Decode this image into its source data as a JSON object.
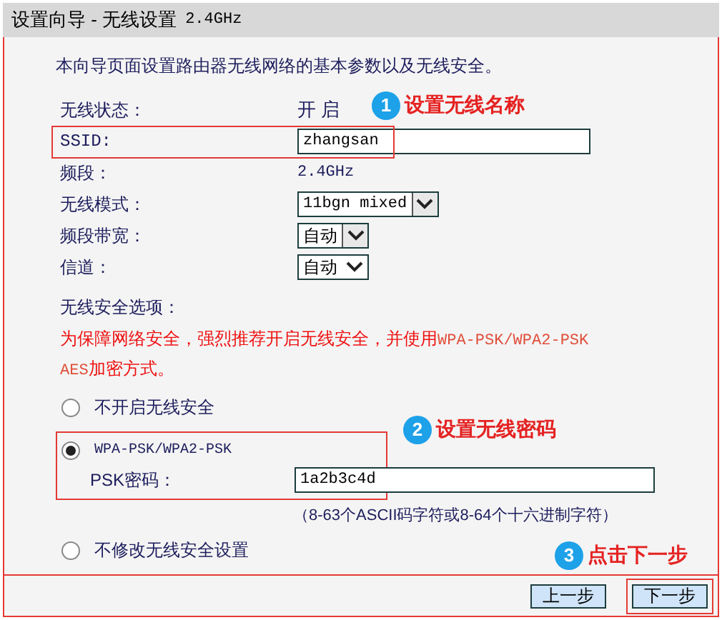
{
  "window": {
    "title": "设置向导 - 无线设置",
    "title_suffix": "2.4GHz"
  },
  "intro": "本向导页面设置路由器无线网络的基本参数以及无线安全。",
  "fields": [
    {
      "kind": "text",
      "label": "无线状态：",
      "value": "开 启"
    },
    {
      "kind": "input",
      "label": "SSID:",
      "value": "zhangsan",
      "highlighted": true
    },
    {
      "kind": "text",
      "label": "频段：",
      "value": "2.4GHz"
    },
    {
      "kind": "select",
      "label": "无线模式：",
      "value": "11bgn mixed"
    },
    {
      "kind": "select",
      "label": "频段带宽：",
      "value": "自动"
    },
    {
      "kind": "select",
      "label": "信道：",
      "value": "自动"
    }
  ],
  "security": {
    "label": "无线安全选项：",
    "warning": "为保障网络安全，强烈推荐开启无线安全，并使用**WPA-PSK/WPA2-PSK AES**加密方式。",
    "options": [
      {
        "label": "不开启无线安全",
        "selected": false,
        "highlighted": false
      },
      {
        "label": "WPA-PSK/WPA2-PSK",
        "selected": true,
        "highlighted": true,
        "field": {
          "label": "PSK密码：",
          "value": "1a2b3c4d"
        },
        "hint": "（8-63个ASCII码字符或8-64个十六进制字符）"
      },
      {
        "label": "不修改无线安全设置",
        "selected": false,
        "highlighted": false
      }
    ]
  },
  "annotations": [
    {
      "number": "1",
      "text": "设置无线名称"
    },
    {
      "number": "2",
      "text": "设置无线密码"
    },
    {
      "number": "3",
      "text": "点击下一步"
    }
  ],
  "buttons": [
    {
      "label": "上一步",
      "highlighted": false
    },
    {
      "label": "下一步",
      "highlighted": true
    }
  ]
}
